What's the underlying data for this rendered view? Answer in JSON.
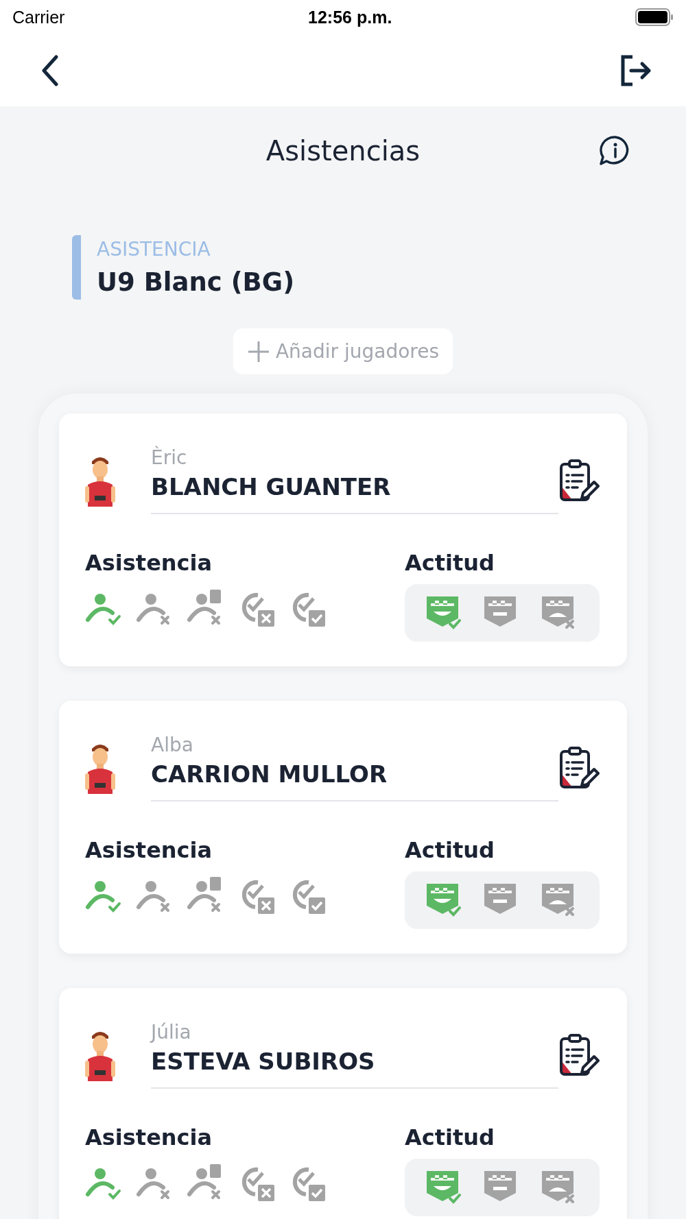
{
  "status_bar": {
    "carrier": "Carrier",
    "time": "12:56 p.m."
  },
  "header": {
    "title": "Asistencias"
  },
  "session": {
    "label": "ASISTENCIA",
    "team": "U9 Blanc (BG)"
  },
  "add_button": {
    "label": "Añadir jugadores"
  },
  "players": [
    {
      "first_name": "Èric",
      "last_name": "BLANCH GUANTER",
      "attendance_label": "Asistencia",
      "attitude_label": "Actitud",
      "attendance": [
        {
          "kind": "present",
          "selected": true
        },
        {
          "kind": "absent",
          "selected": false
        },
        {
          "kind": "justified",
          "selected": false
        },
        {
          "kind": "late-unjustified",
          "selected": false
        },
        {
          "kind": "late-justified",
          "selected": false
        }
      ],
      "attitude": [
        {
          "kind": "good",
          "selected": true
        },
        {
          "kind": "neutral",
          "selected": false
        },
        {
          "kind": "bad",
          "selected": false
        }
      ]
    },
    {
      "first_name": "Alba",
      "last_name": "CARRION MULLOR",
      "attendance_label": "Asistencia",
      "attitude_label": "Actitud",
      "attendance": [
        {
          "kind": "present",
          "selected": true
        },
        {
          "kind": "absent",
          "selected": false
        },
        {
          "kind": "justified",
          "selected": false
        },
        {
          "kind": "late-unjustified",
          "selected": false
        },
        {
          "kind": "late-justified",
          "selected": false
        }
      ],
      "attitude": [
        {
          "kind": "good",
          "selected": true
        },
        {
          "kind": "neutral",
          "selected": false
        },
        {
          "kind": "bad",
          "selected": false
        }
      ]
    },
    {
      "first_name": "Júlia",
      "last_name": "ESTEVA SUBIROS",
      "attendance_label": "Asistencia",
      "attitude_label": "Actitud",
      "attendance": [
        {
          "kind": "present",
          "selected": true
        },
        {
          "kind": "absent",
          "selected": false
        },
        {
          "kind": "justified",
          "selected": false
        },
        {
          "kind": "late-unjustified",
          "selected": false
        },
        {
          "kind": "late-justified",
          "selected": false
        }
      ],
      "attitude": [
        {
          "kind": "good",
          "selected": true
        },
        {
          "kind": "neutral",
          "selected": false
        },
        {
          "kind": "bad",
          "selected": false
        }
      ]
    }
  ]
}
